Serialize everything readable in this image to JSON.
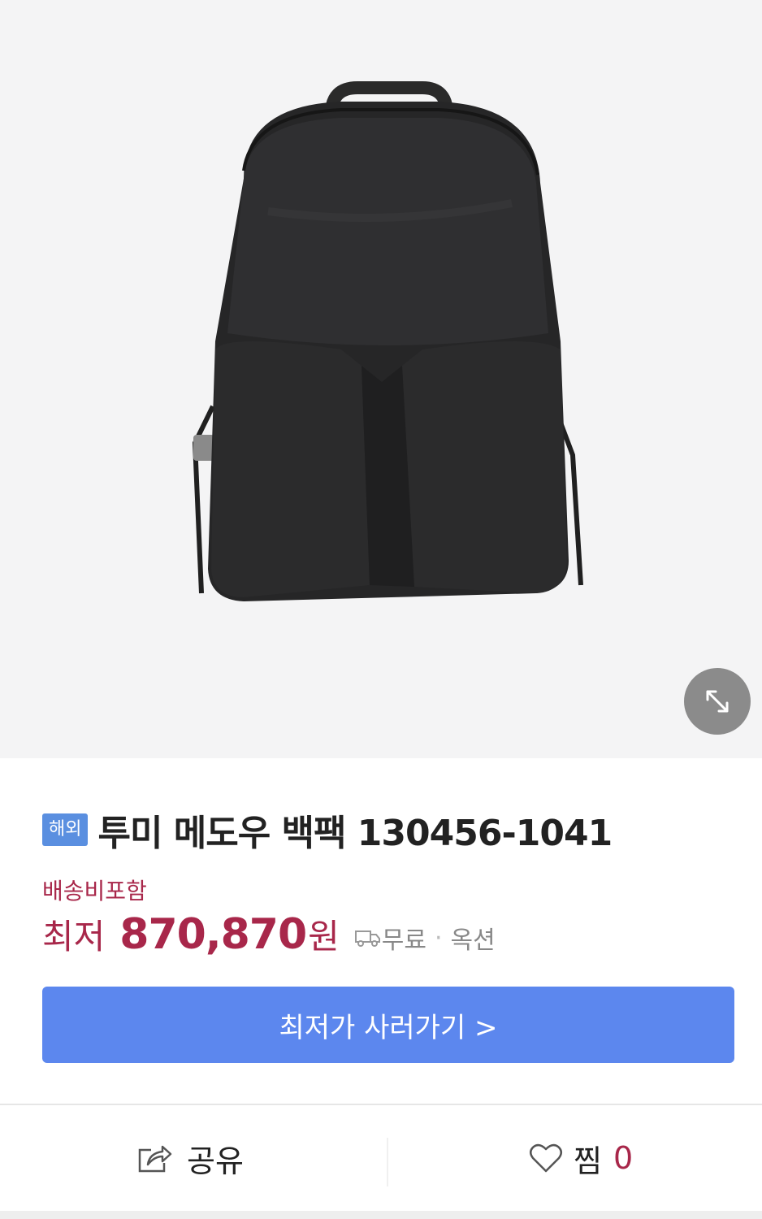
{
  "product": {
    "image_alt": "black backpack",
    "badge": "해외",
    "title": "투미 메도우 백팩 130456-1041",
    "shipping_note": "배송비포함",
    "price_prefix": "최저",
    "price": "870,870",
    "price_unit": "원",
    "shipping_label": "무료",
    "seller_label": "옥션"
  },
  "buy_button": {
    "label": "최저가 사러가기 >"
  },
  "actions": {
    "share_label": "공유",
    "like_label": "찜",
    "like_count": "0"
  },
  "icons": {
    "zoom": "expand-arrows-icon",
    "truck": "truck-icon",
    "share": "share-icon",
    "like": "heart-icon"
  },
  "colors": {
    "accent_price": "#a8274a",
    "buy_button": "#5c87ee",
    "badge": "#5a8fe0",
    "image_bg": "#f4f4f5"
  }
}
